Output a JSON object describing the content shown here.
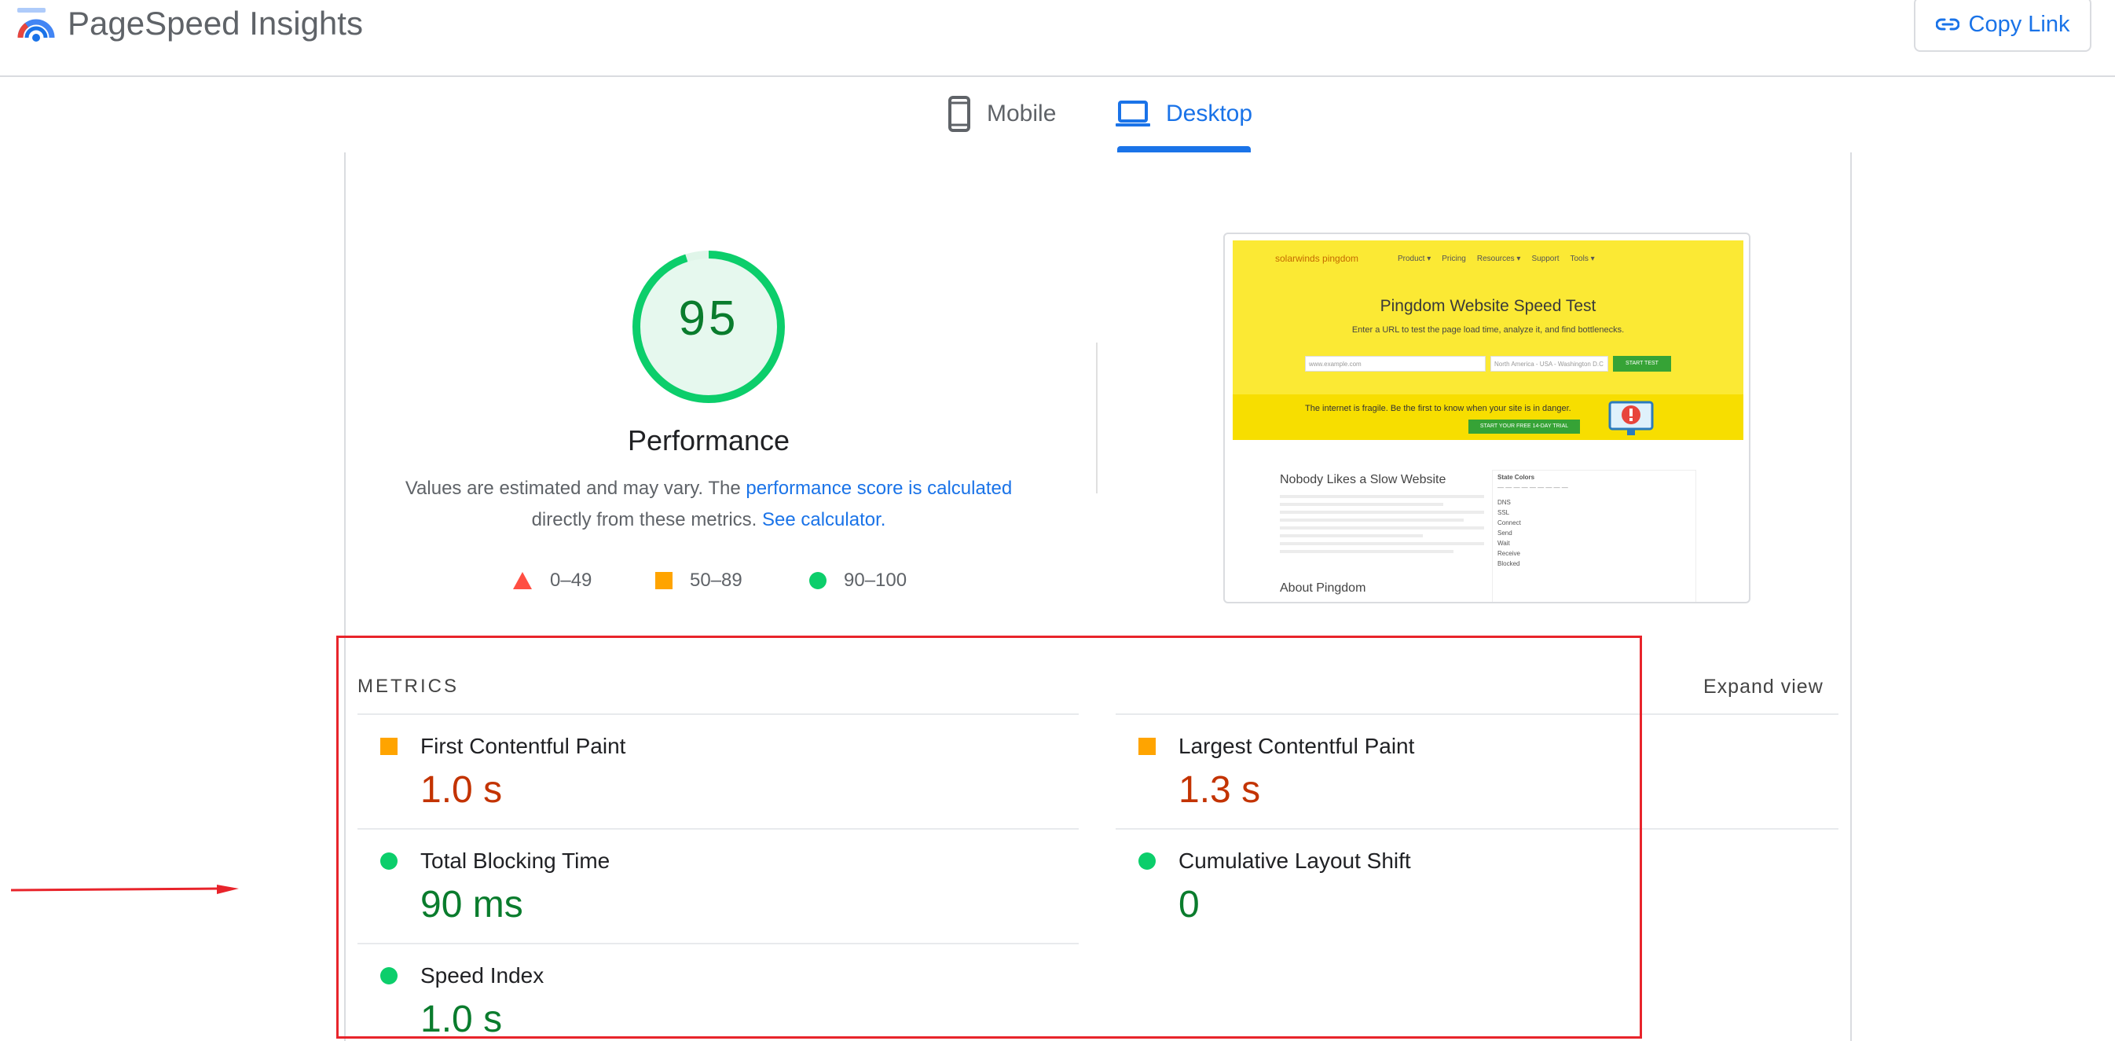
{
  "header": {
    "title": "PageSpeed Insights",
    "copy_link": "Copy Link"
  },
  "tabs": [
    {
      "label": "Mobile",
      "active": false
    },
    {
      "label": "Desktop",
      "active": true
    }
  ],
  "performance": {
    "score": "95",
    "title": "Performance",
    "desc_prefix": "Values are estimated and may vary. The ",
    "desc_link": "performance score is calculated",
    "desc_middle": "directly from these metrics. ",
    "desc_calc": "See calculator.",
    "legend": [
      "0–49",
      "50–89",
      "90–100"
    ]
  },
  "screenshot": {
    "logo": "solarwinds pingdom",
    "nav": [
      "Product ▾",
      "Pricing",
      "Resources ▾",
      "Support",
      "Tools ▾"
    ],
    "title": "Pingdom Website Speed Test",
    "subtitle": "Enter a URL to test the page load time, analyze it, and find bottlenecks.",
    "url_placeholder": "www.example.com",
    "test_from": "North America - USA - Washington D.C",
    "start_test": "START TEST",
    "band_text": "The internet is fragile. Be the first to know when your site is in danger.",
    "band_button": "START YOUR FREE 14-DAY TRIAL",
    "heading1": "Nobody Likes a Slow Website",
    "heading2": "About Pingdom",
    "states_title": "State Colors",
    "states": [
      "DNS",
      "SSL",
      "Connect",
      "Send",
      "Wait",
      "Receive",
      "Blocked"
    ]
  },
  "metrics": {
    "label": "METRICS",
    "expand": "Expand view",
    "items": [
      {
        "name": "First Contentful Paint",
        "value": "1.0 s",
        "rating": "average"
      },
      {
        "name": "Largest Contentful Paint",
        "value": "1.3 s",
        "rating": "average"
      },
      {
        "name": "Total Blocking Time",
        "value": "90 ms",
        "rating": "good"
      },
      {
        "name": "Cumulative Layout Shift",
        "value": "0",
        "rating": "good"
      },
      {
        "name": "Speed Index",
        "value": "1.0 s",
        "rating": "good"
      }
    ]
  },
  "colors": {
    "accent": "#1a73e8",
    "good": "#0cce6b",
    "average": "#ffa400",
    "poor": "#ff4e42",
    "annotation": "#e8242b"
  }
}
